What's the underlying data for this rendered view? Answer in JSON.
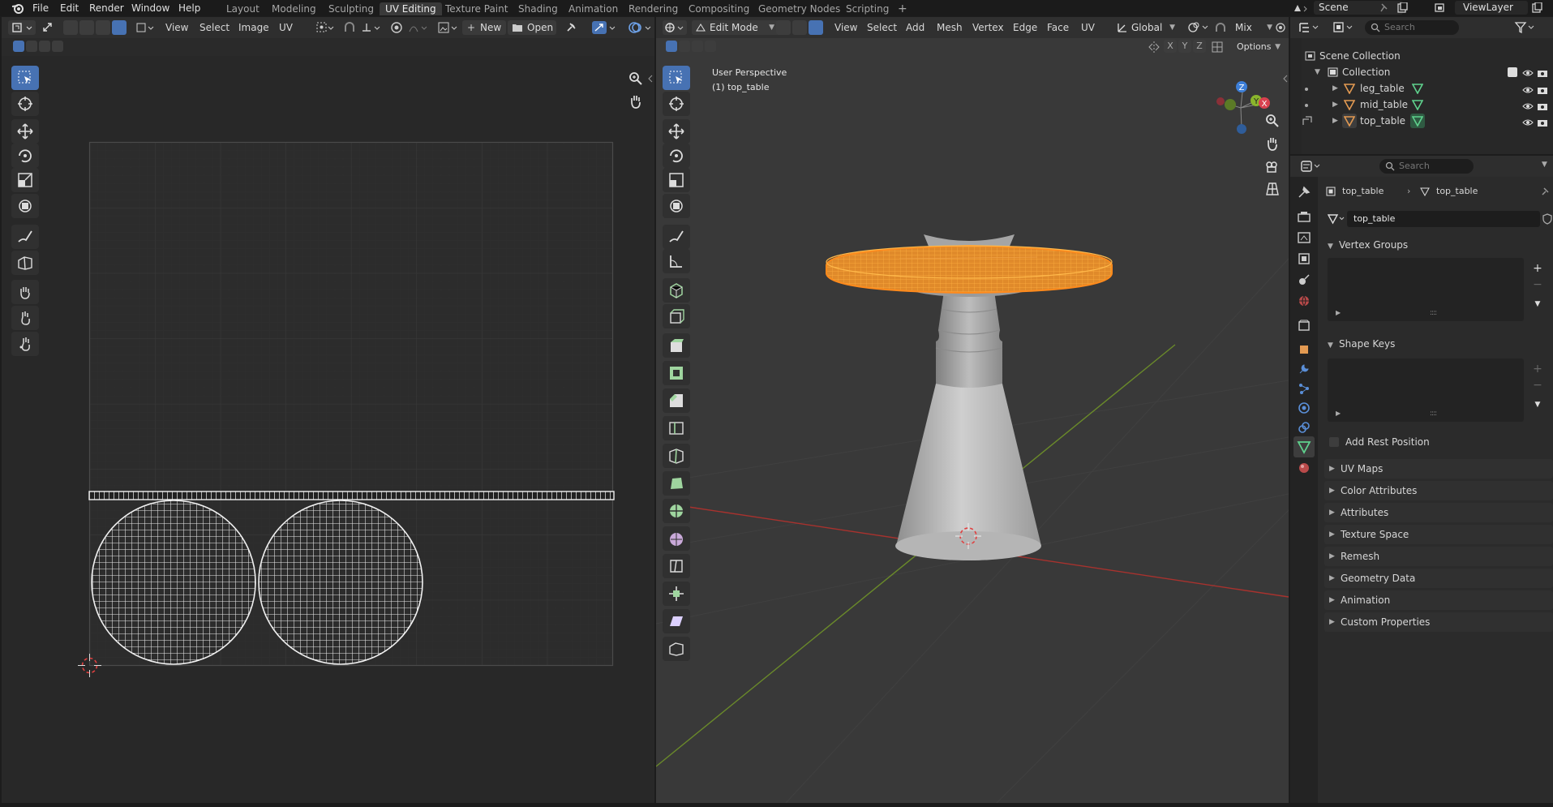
{
  "topbar": {
    "menus": [
      "File",
      "Edit",
      "Render",
      "Window",
      "Help"
    ],
    "workspaces": [
      "Layout",
      "Modeling",
      "Sculpting",
      "UV Editing",
      "Texture Paint",
      "Shading",
      "Animation",
      "Rendering",
      "Compositing",
      "Geometry Nodes",
      "Scripting"
    ],
    "active_workspace": "UV Editing",
    "add_tab": "+",
    "scene": "Scene",
    "view_layer": "ViewLayer"
  },
  "uv_editor": {
    "menus": [
      "View",
      "Select",
      "Image",
      "UV"
    ],
    "new_label": "New",
    "open_label": "Open"
  },
  "viewport": {
    "mode": "Edit Mode",
    "menus": [
      "View",
      "Select",
      "Add",
      "Mesh",
      "Vertex",
      "Edge",
      "Face",
      "UV"
    ],
    "orientation": "Global",
    "snap_mix": "Mix",
    "axes": [
      "X",
      "Y",
      "Z"
    ],
    "options_label": "Options",
    "overlay_line1": "User Perspective",
    "overlay_line2": "(1) top_table",
    "gizmo_labels": [
      "Z",
      "Y",
      "X"
    ],
    "colors": {
      "selection": "#ff8a1c",
      "x_axis": "#a8322e",
      "y_axis": "#6a8a2a"
    }
  },
  "outliner": {
    "search_placeholder": "Search",
    "scene_collection": "Scene Collection",
    "collection": "Collection",
    "objects": [
      "leg_table",
      "mid_table",
      "top_table"
    ]
  },
  "properties": {
    "search_placeholder": "Search",
    "breadcrumb_object": "top_table",
    "breadcrumb_mesh": "top_table",
    "mesh_name": "top_table",
    "vertex_groups": "Vertex Groups",
    "shape_keys": "Shape Keys",
    "add_rest_position": "Add Rest Position",
    "collapsed_panels": [
      "UV Maps",
      "Color Attributes",
      "Attributes",
      "Texture Space",
      "Remesh",
      "Geometry Data",
      "Animation",
      "Custom Properties"
    ]
  }
}
